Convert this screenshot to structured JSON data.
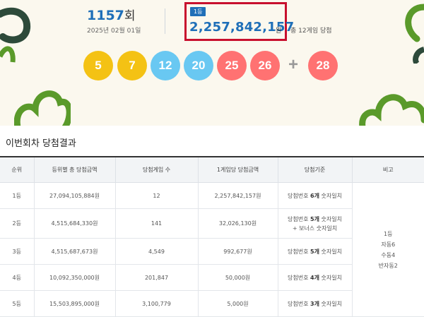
{
  "draw": {
    "round_number": "1157",
    "round_suffix": "회",
    "date": "2025년 02월 01일",
    "first_prize_badge": "1등",
    "first_prize_amount": "2,257,842,157",
    "first_prize_unit": "원",
    "first_prize_winners_text": "총 12게임 당첨"
  },
  "numbers": [
    {
      "value": "5",
      "color": "#f4c214"
    },
    {
      "value": "7",
      "color": "#f4c214"
    },
    {
      "value": "12",
      "color": "#69c8f2"
    },
    {
      "value": "20",
      "color": "#69c8f2"
    },
    {
      "value": "25",
      "color": "#ff7272"
    },
    {
      "value": "26",
      "color": "#ff7272"
    }
  ],
  "plus_sign": "+",
  "bonus": {
    "value": "28",
    "color": "#ff7272"
  },
  "section_title": "이번회차 당첨결과",
  "table": {
    "headers": [
      "순위",
      "등위별 총 당첨금액",
      "당첨게임 수",
      "1게임당 당첨금액",
      "당첨기준",
      "비고"
    ],
    "rows": [
      {
        "rank": "1등",
        "total": "27,094,105,884원",
        "games": "12",
        "per_game": "2,257,842,157원",
        "crit_pre": "당첨번호 ",
        "crit_bold": "6개",
        "crit_post": " 숫자일치",
        "crit_line2": ""
      },
      {
        "rank": "2등",
        "total": "4,515,684,330원",
        "games": "141",
        "per_game": "32,026,130원",
        "crit_pre": "당첨번호 ",
        "crit_bold": "5개",
        "crit_post": " 숫자일치",
        "crit_line2": "+ 보너스 숫자일치"
      },
      {
        "rank": "3등",
        "total": "4,515,687,673원",
        "games": "4,549",
        "per_game": "992,677원",
        "crit_pre": "당첨번호 ",
        "crit_bold": "5개",
        "crit_post": " 숫자일치",
        "crit_line2": ""
      },
      {
        "rank": "4등",
        "total": "10,092,350,000원",
        "games": "201,847",
        "per_game": "50,000원",
        "crit_pre": "당첨번호 ",
        "crit_bold": "4개",
        "crit_post": " 숫자일치",
        "crit_line2": ""
      },
      {
        "rank": "5등",
        "total": "15,503,895,000원",
        "games": "3,100,779",
        "per_game": "5,000원",
        "crit_pre": "당첨번호 ",
        "crit_bold": "3개",
        "crit_post": " 숫자일치",
        "crit_line2": ""
      }
    ],
    "remarks": [
      "1등",
      "자동6",
      "수동4",
      "반자동2"
    ]
  },
  "colors": {
    "accent_blue": "#1f6fb8",
    "highlight_red": "#c8102e",
    "deco_green": "#5a9a2a",
    "deco_dark_green": "#2d4a3a"
  }
}
